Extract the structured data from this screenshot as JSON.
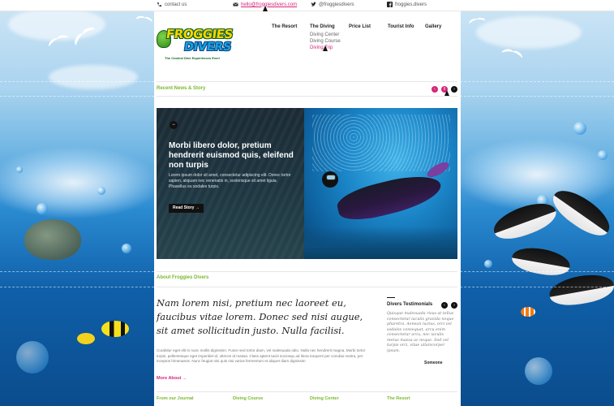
{
  "topbar": {
    "contact": "contact us",
    "email": "hello@froggiesdivers.com",
    "twitter": "@froggiesdivers",
    "facebook": "froggies.divers"
  },
  "logo": {
    "line1": "FROGGIES",
    "line2": "DIVERS",
    "tagline": "The Coolest Dive Experiences Ever!"
  },
  "nav": {
    "items": [
      "The Resort",
      "The Diving",
      "Price List",
      "Tourist Info",
      "Gallery"
    ],
    "diving_sub": [
      "Diving Center",
      "Diving Course",
      "Diving Trip"
    ]
  },
  "news": {
    "title": "Recent News & Story",
    "story_heading": "Morbi libero dolor, pretium hendrerit euismod quis, eleifend non turpis",
    "story_text": "Lorem ipsum dolor sit amet, consectetur adipiscing elit. Donec tortor sapien, aliquam nec venenatis in, scelerisque sit amet ligula. Phasellus eu sodales turpis.",
    "read_more": "Read Story →"
  },
  "about": {
    "title": "About Froggies Divers",
    "quote": "Nam lorem nisi, pretium nec laoreet eu, faucibus vitae lorem. Donec sed nisi augue, sit amet sollicitudin justo. Nulla facilisi.",
    "text": "Curabitur eget elit in nunc mollis dignissim. Fusce sed tortor diam, vel malesuada odio. Nulla nec hendrerit magna. Morbi tortor turpis, pellentesque eget imperdiet id, ultrices id massa. Class aptent taciti sociosqu ad litora torquent per conubia nostra, per inceptos himenaeos. Nunc feugiat nisi quis nisi varius fermentum et aliquet diam dignissim",
    "more": "More About →"
  },
  "testimonials": {
    "title": "Divers Testimonials",
    "text": "Quisque malesuada risus at tellus consectetur iaculis gravida neque pharetra. Aenean luctus, orci vel sodales consequat, arcu enim consectetur arcu, nec iaculis metus massa ac neque. Sed vel turpis orci, vitae ullamcorper ipsum.",
    "author": "Someone"
  },
  "footer": {
    "cols": [
      "From our Journal",
      "Diving Course",
      "Diving Center",
      "The Resort"
    ]
  },
  "colors": {
    "accent_pink": "#d4277b",
    "section_green": "#7ab92e"
  }
}
